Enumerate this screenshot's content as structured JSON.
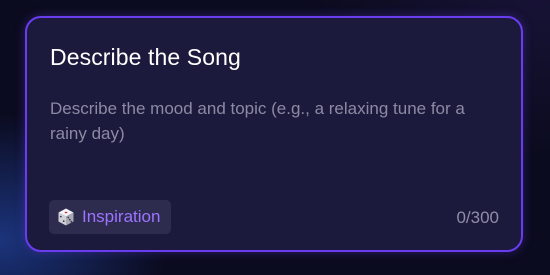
{
  "card": {
    "title": "Describe the Song",
    "description_field": {
      "value": "",
      "placeholder": "Describe the mood and topic (e.g., a relaxing tune for a rainy day)"
    },
    "inspiration_button": {
      "label": "Inspiration",
      "icon": "dice-icon"
    },
    "char_count": "0/300"
  },
  "colors": {
    "accent_border": "#6a3cf0",
    "card_background": "#1b1a3c",
    "inspiration_text": "#9d73ff",
    "button_background": "#2d2c4f"
  }
}
